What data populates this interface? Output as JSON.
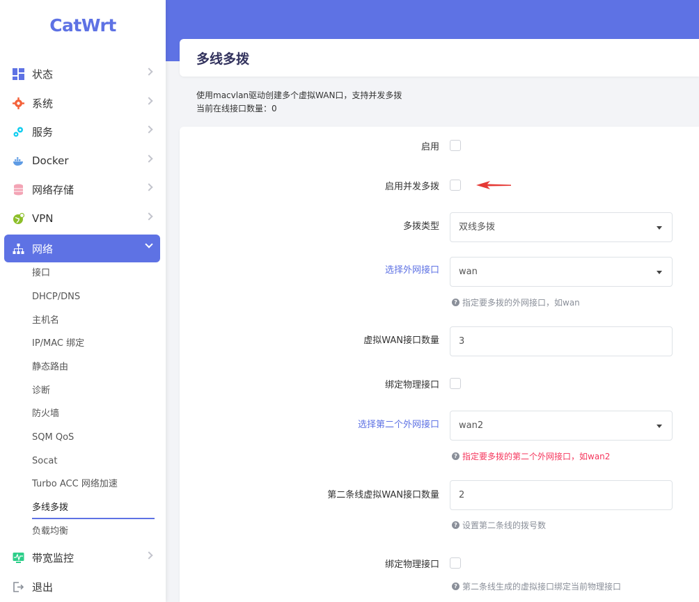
{
  "app": {
    "logo": "CatWrt"
  },
  "sidebar": {
    "menu": [
      {
        "label": "状态",
        "icon": "dashboard-icon"
      },
      {
        "label": "系统",
        "icon": "gear-icon"
      },
      {
        "label": "服务",
        "icon": "services-icon"
      },
      {
        "label": "Docker",
        "icon": "docker-icon"
      },
      {
        "label": "网络存储",
        "icon": "database-icon"
      },
      {
        "label": "VPN",
        "icon": "vpn-icon"
      },
      {
        "label": "网络",
        "icon": "network-icon"
      },
      {
        "label": "带宽监控",
        "icon": "monitor-icon"
      },
      {
        "label": "退出",
        "icon": "logout-icon"
      }
    ],
    "network_sub": [
      "接口",
      "DHCP/DNS",
      "主机名",
      "IP/MAC 绑定",
      "静态路由",
      "诊断",
      "防火墙",
      "SQM QoS",
      "Socat",
      "Turbo ACC 网络加速",
      "多线多拨",
      "负载均衡"
    ],
    "active_sub_index": 10
  },
  "page": {
    "title": "多线多拨",
    "description_line1": "使用macvlan驱动创建多个虚拟WAN口，支持并发多拨",
    "description_line2": "当前在线接口数量：0"
  },
  "form": {
    "enable_label": "启用",
    "concurrent_label": "启用并发多拨",
    "type_label": "多拨类型",
    "type_value": "双线多拨",
    "wan_label": "选择外网接口",
    "wan_value": "wan",
    "wan_hint": "指定要多拨的外网接口，如wan",
    "vwan_count_label": "虚拟WAN接口数量",
    "vwan_count_value": "3",
    "bind_phys_label": "绑定物理接口",
    "wan2_label": "选择第二个外网接口",
    "wan2_value": "wan2",
    "wan2_hint": "指定要多拨的第二个外网接口，如wan2",
    "vwan2_count_label": "第二条线虚拟WAN接口数量",
    "vwan2_count_value": "2",
    "vwan2_hint": "设置第二条线的拨号数",
    "bind_phys2_label": "绑定物理接口",
    "bind_phys2_hint": "第二条线生成的虚拟接口绑定当前物理接口"
  },
  "colors": {
    "accent": "#5e72e4",
    "warn": "#f5365c",
    "arrow": "#e53935"
  }
}
